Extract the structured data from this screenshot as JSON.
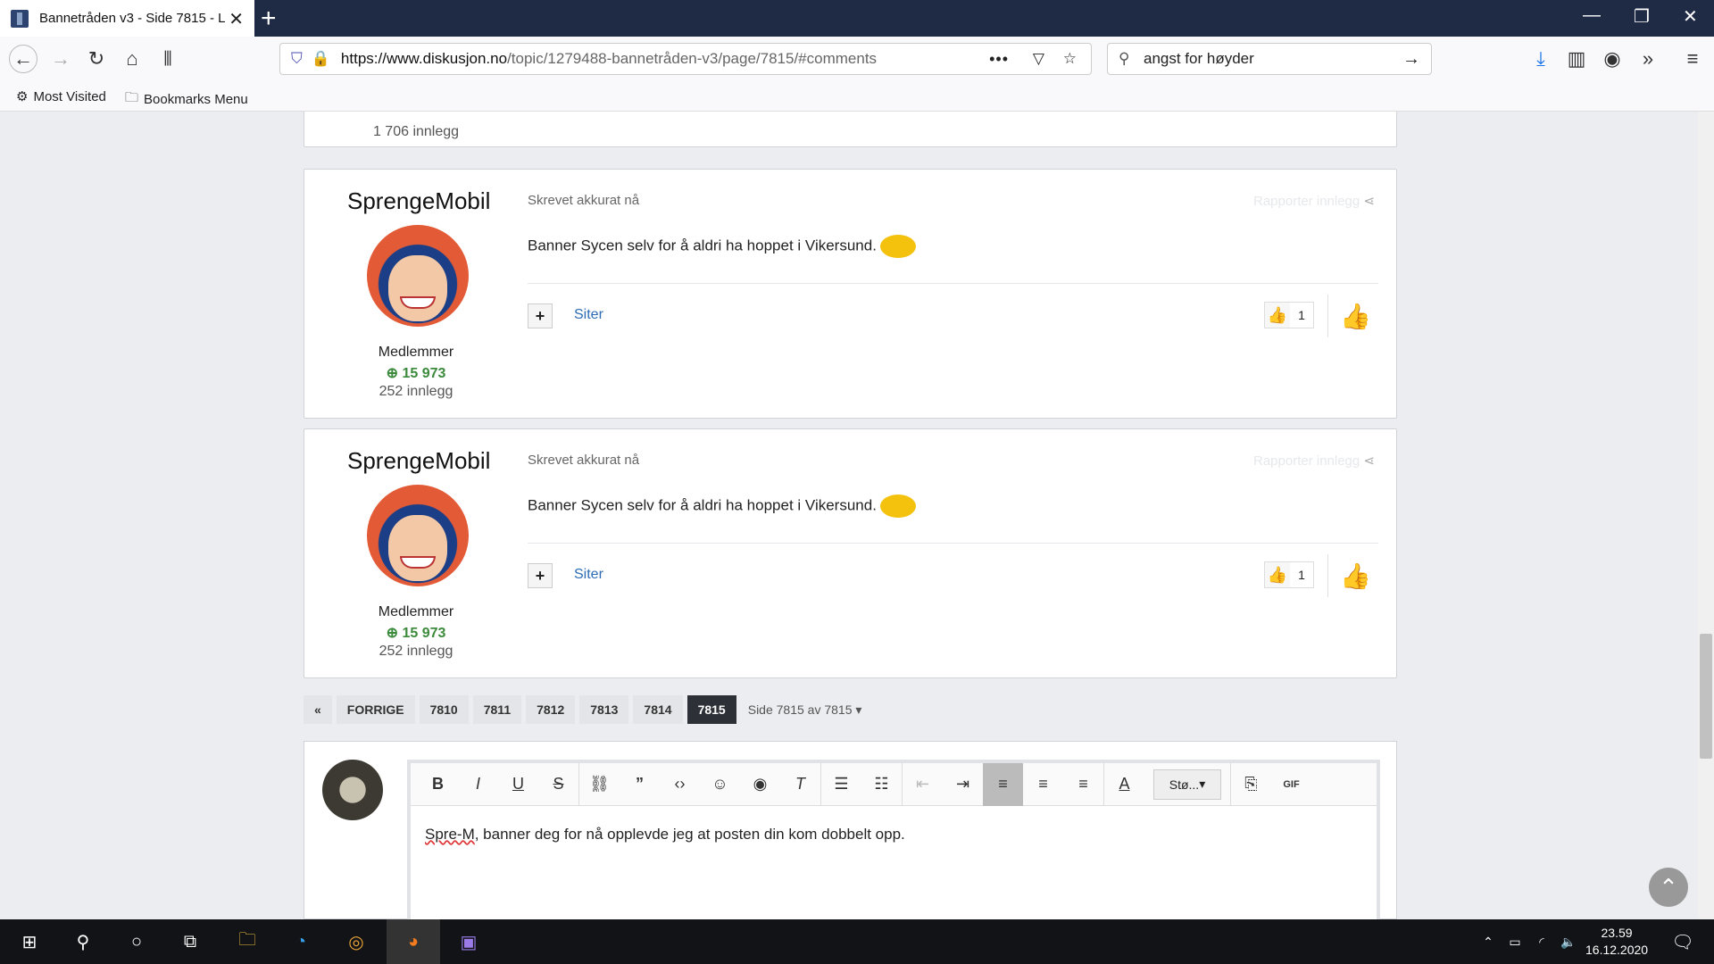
{
  "browser": {
    "tab_title": "Bannetråden v3 - Side 7815 - L",
    "url_domain": "https://www.diskusjon.no",
    "url_path": "/topic/1279488-bannetråden-v3/page/7815/#comments",
    "search_value": "angst for høyder",
    "bookmarks": [
      "Most Visited",
      "Bookmarks Menu"
    ]
  },
  "prev_post": {
    "count": "1 706 innlegg"
  },
  "posts": [
    {
      "author": "SprengeMobil",
      "time": "Skrevet akkurat nå",
      "report": "Rapporter innlegg",
      "body": "Banner Sycen selv for å aldri ha hoppet i Vikersund.",
      "group": "Medlemmer",
      "rep": "15 973",
      "count": "252 innlegg",
      "quote": "Siter",
      "likes": "1"
    },
    {
      "author": "SprengeMobil",
      "time": "Skrevet akkurat nå",
      "report": "Rapporter innlegg",
      "body": "Banner Sycen selv for å aldri ha hoppet i Vikersund.",
      "group": "Medlemmer",
      "rep": "15 973",
      "count": "252 innlegg",
      "quote": "Siter",
      "likes": "1"
    }
  ],
  "pagination": {
    "prev": "FORRIGE",
    "pages": [
      "7810",
      "7811",
      "7812",
      "7813",
      "7814",
      "7815"
    ],
    "info": "Side 7815 av 7815"
  },
  "editor": {
    "font_select": "Stø...",
    "text_misspelled": "Spre-M",
    "text_rest": ", banner deg for nå opplevde jeg at posten din kom dobbelt opp."
  },
  "taskbar": {
    "time": "23.59",
    "date": "16.12.2020"
  }
}
